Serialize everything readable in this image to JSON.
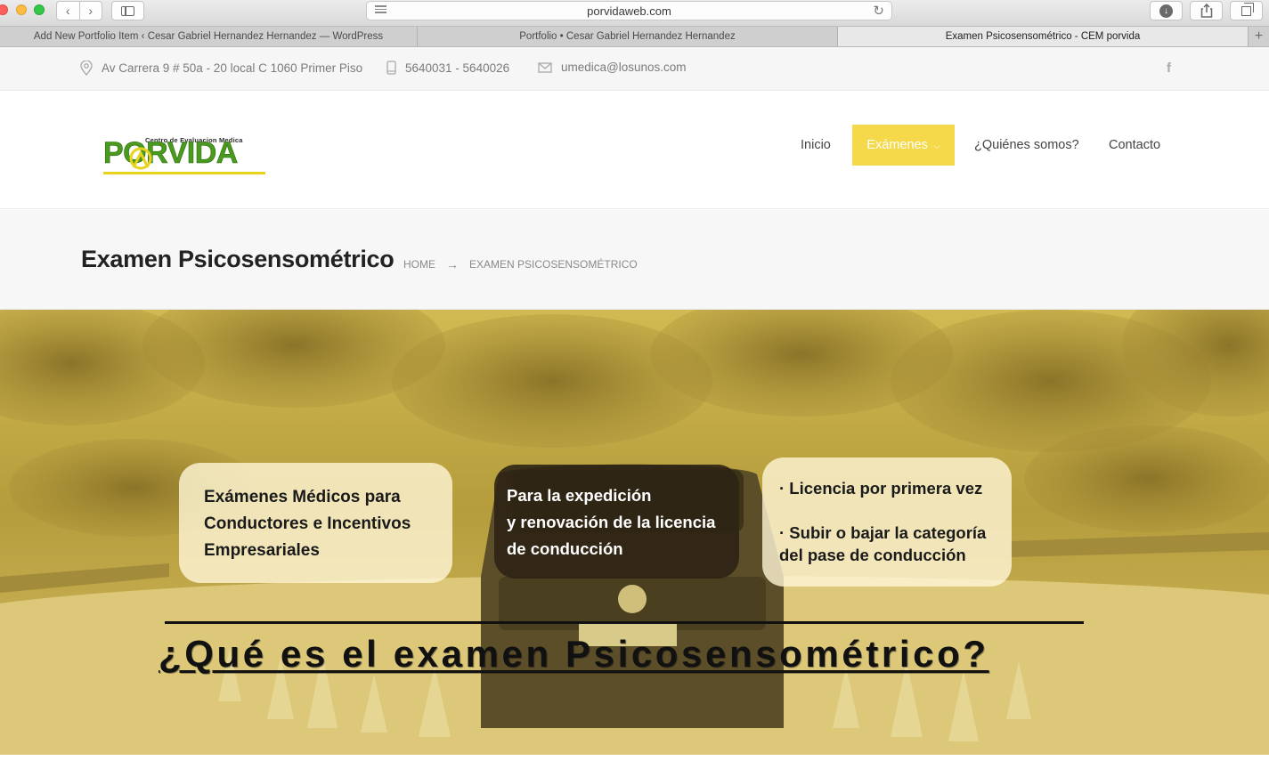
{
  "browser": {
    "url": "porvidaweb.com",
    "tabs": [
      {
        "title": "Add New Portfolio Item ‹ Cesar Gabriel Hernandez Hernandez — WordPress"
      },
      {
        "title": "Portfolio • Cesar Gabriel Hernandez Hernandez"
      },
      {
        "title": "Examen Psicosensométrico - CEM porvida"
      }
    ],
    "new_tab_label": "+"
  },
  "topbar": {
    "address": "Av Carrera 9 # 50a - 20 local C 1060 Primer Piso",
    "phone": "5640031 - 5640026",
    "email": "umedica@losunos.com",
    "social": "f"
  },
  "logo": {
    "tagline": "Centro de Evaluacion Medica",
    "word": "PORVIDA",
    "colors": {
      "green": "#4a9a1e",
      "yellow": "#e8d21b"
    }
  },
  "nav": {
    "items": [
      {
        "label": "Inicio"
      },
      {
        "label": "Exámenes",
        "active": true
      },
      {
        "label": "¿Quiénes somos?"
      },
      {
        "label": "Contacto"
      }
    ],
    "accent": "#f5d94a"
  },
  "page": {
    "title": "Examen Psicosensométrico",
    "breadcrumb": {
      "home": "Home",
      "separator": "→",
      "current": "Examen Psicosensométrico"
    }
  },
  "hero": {
    "card1": [
      "Exámenes Médicos para",
      "Conductores e Incentivos",
      "Empresariales"
    ],
    "card2": [
      "Para la expedición",
      "y renovación de la licencia",
      "de conducción"
    ],
    "card3": [
      "· Licencia por primera vez",
      "· Subir o bajar la categoría",
      "del pase de conducción"
    ],
    "heading": "¿Qué es el examen Psicosensométrico?"
  }
}
